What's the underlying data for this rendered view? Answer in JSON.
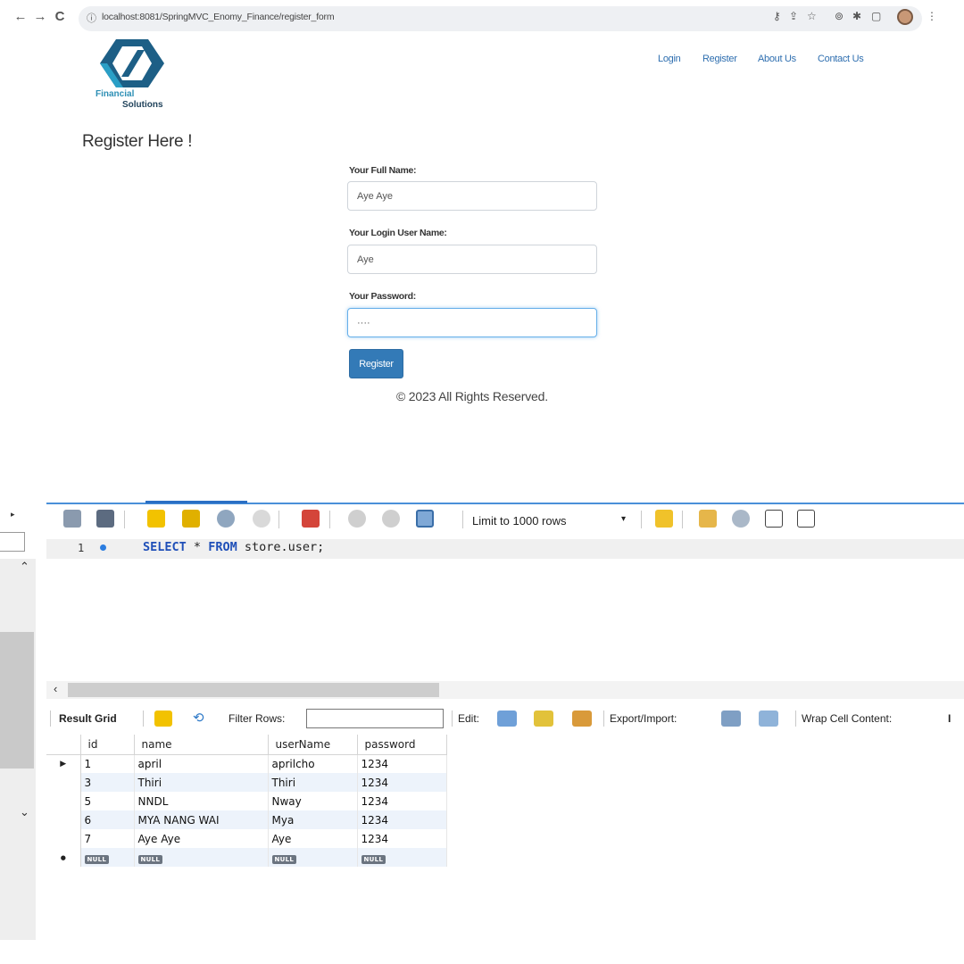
{
  "browser": {
    "url": "localhost:8081/SpringMVC_Enomy_Finance/register_form",
    "back": "←",
    "forward": "→",
    "reload": "C",
    "info": "ⓘ"
  },
  "site": {
    "logo_line1": "Financial",
    "logo_line2": "Solutions",
    "nav": [
      "Login",
      "Register",
      "About Us",
      "Contact Us"
    ],
    "title": "Register Here !",
    "form": {
      "full_name_label": "Your Full Name:",
      "full_name_value": "Aye Aye",
      "username_label": "Your Login User Name:",
      "username_value": "Aye",
      "password_label": "Your Password:",
      "password_value": "····",
      "submit_label": "Register"
    },
    "footer": "© 2023 All Rights Reserved."
  },
  "workbench": {
    "limit_label": "Limit to 1000 rows",
    "limit_arrow": "▾",
    "line_number": "1",
    "query_keyword_select": "SELECT",
    "query_star": "*",
    "query_keyword_from": "FROM",
    "query_table": "store.user;",
    "results": {
      "result_grid_label": "Result Grid",
      "filter_label": "Filter Rows:",
      "edit_label": "Edit:",
      "export_label": "Export/Import:",
      "wrap_label": "Wrap Cell Content:",
      "columns": [
        "id",
        "name",
        "userName",
        "password"
      ],
      "rows": [
        [
          "1",
          "april",
          "aprilcho",
          "1234"
        ],
        [
          "3",
          "Thiri",
          "Thiri",
          "1234"
        ],
        [
          "5",
          "NNDL",
          "Nway",
          "1234"
        ],
        [
          "6",
          "MYA NANG WAI",
          "Mya",
          "1234"
        ],
        [
          "7",
          "Aye Aye",
          "Aye",
          "1234"
        ]
      ],
      "null_label": "NULL",
      "current_row_marker": "▶",
      "new_row_marker": "●"
    }
  },
  "colors": {
    "accent": "#337ab7",
    "link": "#2f6fb0",
    "sql_keyword": "#1f4fb8",
    "grid_alt_row": "#edf3fb"
  }
}
